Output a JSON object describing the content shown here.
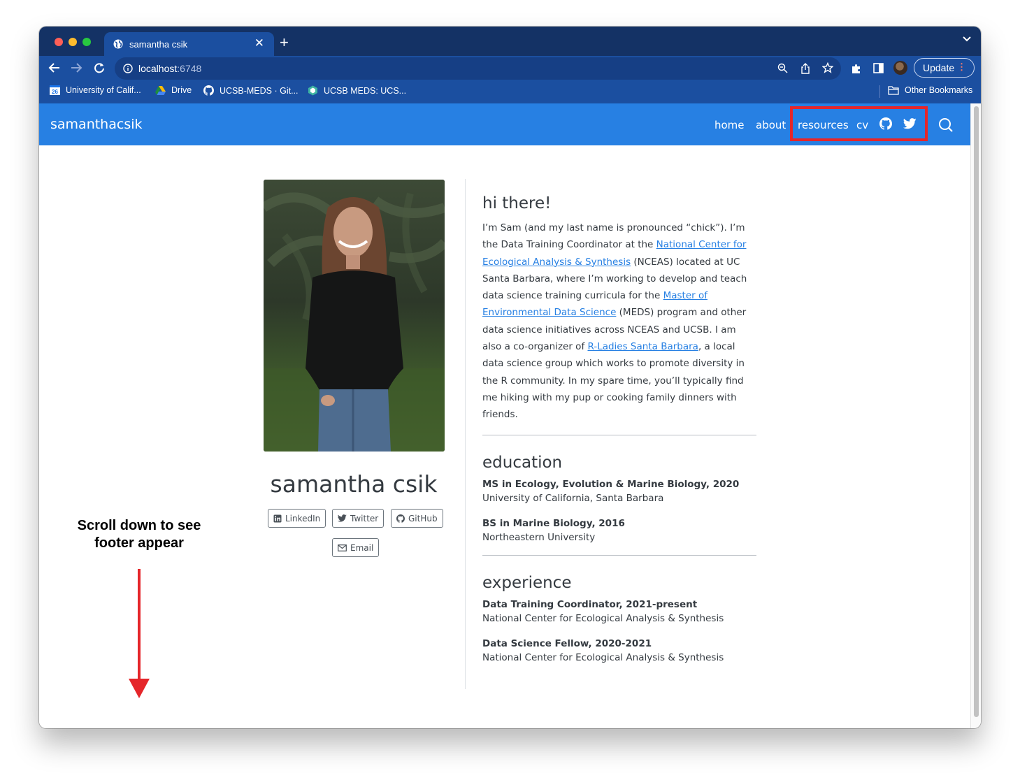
{
  "browser": {
    "tab_title": "samantha csik",
    "url_host": "localhost",
    "url_port": ":6748",
    "update_label": "Update",
    "bookmarks": [
      "University of Calif...",
      "Drive",
      "UCSB-MEDS · Git...",
      "UCSB MEDS: UCS..."
    ],
    "bookmark_calendar_date": "26",
    "other_bookmarks": "Other Bookmarks",
    "colors": {
      "tabstrip": "#143265",
      "toolbar": "#1b4fa0",
      "navbar": "#2780e3",
      "highlight": "#e5262a"
    }
  },
  "site": {
    "brand": "samanthacsik",
    "nav": [
      "home",
      "about",
      "resources",
      "cv"
    ],
    "nav_icons": [
      "github-icon",
      "twitter-icon",
      "search-icon"
    ]
  },
  "profile": {
    "name": "samantha csik",
    "socials": [
      "LinkedIn",
      "Twitter",
      "GitHub",
      "Email"
    ]
  },
  "annotation": {
    "line1": "Scroll down to see",
    "line2": "footer appear"
  },
  "about": {
    "heading": "hi there!",
    "bio_1": "I’m Sam (and my last name is pronounced “chick”). I’m the Data Training Coordinator at the ",
    "link_nceas": "National Center for Ecological Analysis & Synthesis",
    "bio_2": " (NCEAS) located at UC Santa Barbara, where I’m working to develop and teach data science training curricula for the ",
    "link_meds": "Master of Environmental Data Science",
    "bio_3": " (MEDS) program and other data science initiatives across NCEAS and UCSB. I am also a co-organizer of ",
    "link_rladies": "R-Ladies Santa Barbara",
    "bio_4": ", a local data science group which works to promote diversity in the R community. In my spare time, you’ll typically find me hiking with my pup or cooking family dinners with friends."
  },
  "education": {
    "heading": "education",
    "items": [
      {
        "title": "MS in Ecology, Evolution & Marine Biology, 2020",
        "sub": "University of California, Santa Barbara"
      },
      {
        "title": "BS in Marine Biology, 2016",
        "sub": "Northeastern University"
      }
    ]
  },
  "experience": {
    "heading": "experience",
    "items": [
      {
        "title": "Data Training Coordinator, 2021-present",
        "sub": "National Center for Ecological Analysis & Synthesis"
      },
      {
        "title": "Data Science Fellow, 2020-2021",
        "sub": "National Center for Ecological Analysis & Synthesis"
      }
    ]
  }
}
